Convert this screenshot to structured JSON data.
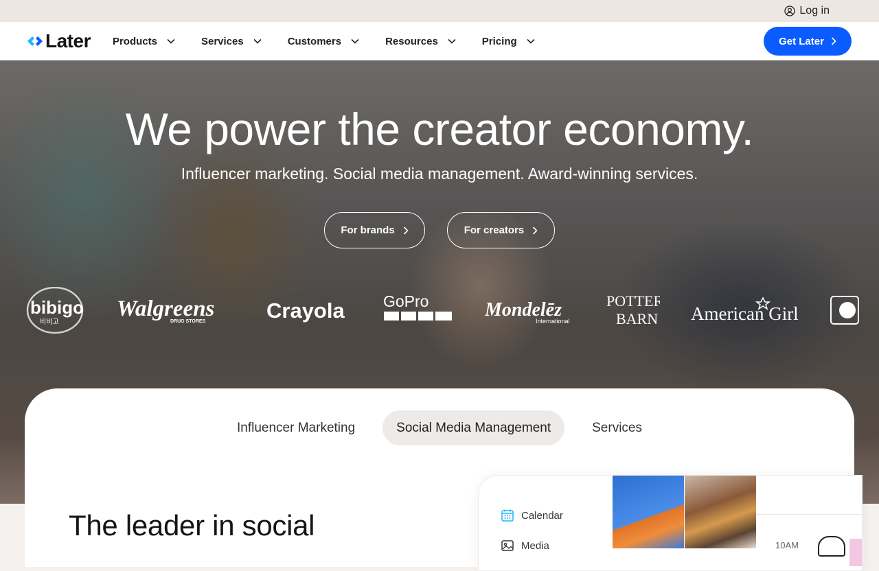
{
  "topbar": {
    "login_label": "Log in"
  },
  "nav": {
    "logo_text": "Later",
    "items": [
      {
        "label": "Products"
      },
      {
        "label": "Services"
      },
      {
        "label": "Customers"
      },
      {
        "label": "Resources"
      },
      {
        "label": "Pricing"
      }
    ],
    "cta_label": "Get Later",
    "cta_color": "#0b5cff"
  },
  "hero": {
    "title": "We power the creator economy.",
    "subtitle": "Influencer marketing. Social media management. Award-winning services.",
    "buttons": [
      {
        "label": "For brands"
      },
      {
        "label": "For creators"
      }
    ],
    "brand_logos": [
      "bibigo",
      "Walgreens",
      "Crayola",
      "GoPro",
      "Mondelēz",
      "Pottery Barn",
      "American Girl"
    ],
    "brand_logo_subtext": {
      "bibigo": "비비고",
      "walgreens": "DRUG STORES",
      "mondelez": "International",
      "pottery_1": "POTTERY",
      "pottery_2": "BARN"
    }
  },
  "panel": {
    "tabs": [
      {
        "label": "Influencer Marketing",
        "active": false
      },
      {
        "label": "Social Media Management",
        "active": true
      },
      {
        "label": "Services",
        "active": false
      }
    ],
    "heading": "The leader in social",
    "mock": {
      "menu": [
        {
          "label": "Calendar",
          "icon": "calendar-icon"
        },
        {
          "label": "Media",
          "icon": "image-icon"
        }
      ],
      "time_label": "10AM"
    }
  }
}
